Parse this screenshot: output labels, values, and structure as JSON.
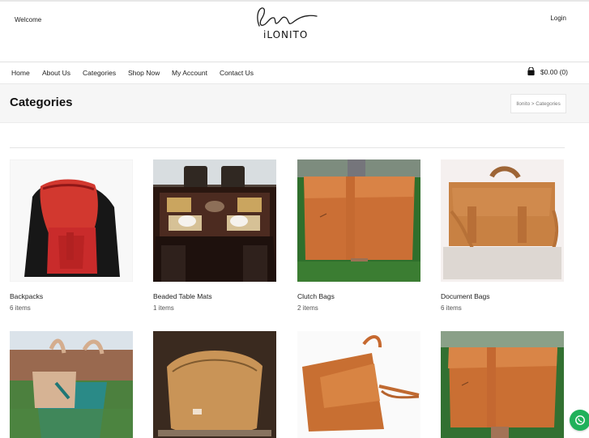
{
  "header": {
    "welcome": "Welcome",
    "login": "Login",
    "logo_text": "iLONITO"
  },
  "nav": {
    "items": [
      {
        "label": "Home"
      },
      {
        "label": "About Us"
      },
      {
        "label": "Categories"
      },
      {
        "label": "Shop Now"
      },
      {
        "label": "My Account"
      },
      {
        "label": "Contact Us"
      }
    ],
    "cart_text": "$0.00 (0)"
  },
  "page": {
    "title": "Categories",
    "breadcrumb": "Ilonito > Categories"
  },
  "categories": [
    {
      "name": "Backpacks",
      "count": "6 items"
    },
    {
      "name": "Beaded Table Mats",
      "count": "1 items"
    },
    {
      "name": "Clutch Bags",
      "count": "2 items"
    },
    {
      "name": "Document Bags",
      "count": "6 items"
    }
  ],
  "colors": {
    "accent": "#20b15a",
    "leather": "#c7722f",
    "red_bag": "#d42d2d",
    "teal_bag": "#1f8c8a"
  },
  "icons": {
    "cart": "shopping-bag-icon",
    "whatsapp": "whatsapp-icon"
  }
}
